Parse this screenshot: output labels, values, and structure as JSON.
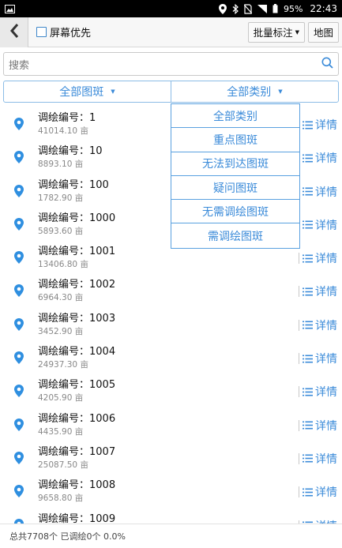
{
  "status_bar": {
    "battery": "95%",
    "time": "22:43",
    "icons": [
      "image-icon",
      "location-icon",
      "bluetooth-icon",
      "no-sim-icon",
      "wifi-icon",
      "battery-icon"
    ]
  },
  "toolbar": {
    "back_icon": "chevron-left-icon",
    "screen_first_label": "屏幕优先",
    "batch_label": "批量标注",
    "map_label": "地图"
  },
  "search": {
    "placeholder": "搜索",
    "icon": "search-icon"
  },
  "filters": {
    "patch_label": "全部图斑",
    "category_label": "全部类别"
  },
  "dropdown": {
    "options": [
      "全部类别",
      "重点图斑",
      "无法到达图斑",
      "疑问图斑",
      "无需调绘图斑",
      "需调绘图斑"
    ]
  },
  "list": {
    "detail_label": "详情",
    "items": [
      {
        "title": "调绘编号：1",
        "area": "41014.10 亩"
      },
      {
        "title": "调绘编号：10",
        "area": "8893.10 亩"
      },
      {
        "title": "调绘编号：100",
        "area": "1782.90 亩"
      },
      {
        "title": "调绘编号：1000",
        "area": "5893.60 亩"
      },
      {
        "title": "调绘编号：1001",
        "area": "13406.80 亩"
      },
      {
        "title": "调绘编号：1002",
        "area": "6964.30 亩"
      },
      {
        "title": "调绘编号：1003",
        "area": "3452.90 亩"
      },
      {
        "title": "调绘编号：1004",
        "area": "24937.30 亩"
      },
      {
        "title": "调绘编号：1005",
        "area": "4205.90 亩"
      },
      {
        "title": "调绘编号：1006",
        "area": "4435.90 亩"
      },
      {
        "title": "调绘编号：1007",
        "area": "25087.50 亩"
      },
      {
        "title": "调绘编号：1008",
        "area": "9658.80 亩"
      },
      {
        "title": "调绘编号：1009",
        "area": ""
      }
    ]
  },
  "footer": {
    "summary": "总共7708个 已调绘0个 0.0%"
  },
  "colors": {
    "accent": "#3b8bd9",
    "pin": "#2f8fe0",
    "border_accent": "#8cbce6"
  }
}
